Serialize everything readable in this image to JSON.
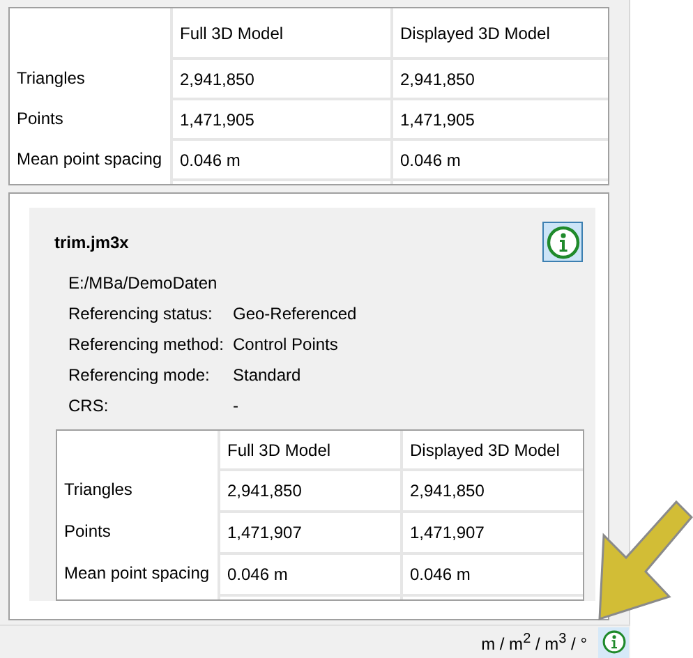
{
  "summary_table": {
    "columns": [
      "Full 3D Model",
      "Displayed 3D Model"
    ],
    "rows": [
      {
        "label": "Triangles",
        "cells": [
          "2,941,850",
          "2,941,850"
        ]
      },
      {
        "label": "Points",
        "cells": [
          "1,471,905",
          "1,471,905"
        ]
      },
      {
        "label": "Mean point spacing",
        "cells": [
          "0.046 m",
          "0.046 m"
        ]
      }
    ]
  },
  "model_card": {
    "title": "trim.jm3x",
    "path": "E:/MBa/DemoDaten",
    "properties": [
      {
        "label": "Referencing status:",
        "value": "Geo-Referenced"
      },
      {
        "label": "Referencing method:",
        "value": "Control Points"
      },
      {
        "label": "Referencing mode:",
        "value": "Standard"
      },
      {
        "label": "CRS:",
        "value": "-"
      }
    ],
    "table": {
      "columns": [
        "Full 3D Model",
        "Displayed 3D Model"
      ],
      "rows": [
        {
          "label": "Triangles",
          "cells": [
            "2,941,850",
            "2,941,850"
          ]
        },
        {
          "label": "Points",
          "cells": [
            "1,471,907",
            "1,471,907"
          ]
        },
        {
          "label": "Mean point spacing",
          "cells": [
            "0.046 m",
            "0.046 m"
          ]
        }
      ]
    }
  },
  "status_bar": {
    "units": "m / m$^{2}$ / m$^{3}$ / °"
  }
}
